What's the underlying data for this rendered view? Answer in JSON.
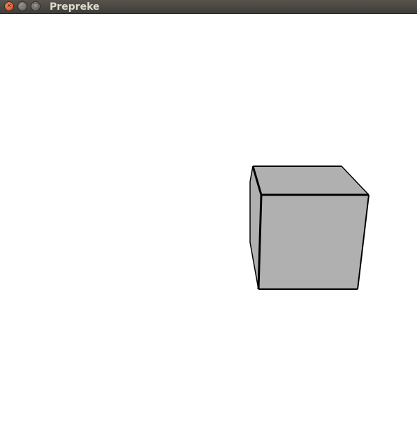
{
  "window": {
    "title": "Prepreke",
    "buttons": {
      "close_icon": "close-icon",
      "min_icon": "minimize-icon",
      "max_icon": "maximize-icon"
    }
  },
  "scene": {
    "background": "#ffffff",
    "cube_fill": "#b0b0b0",
    "edge_color": "#000000"
  }
}
